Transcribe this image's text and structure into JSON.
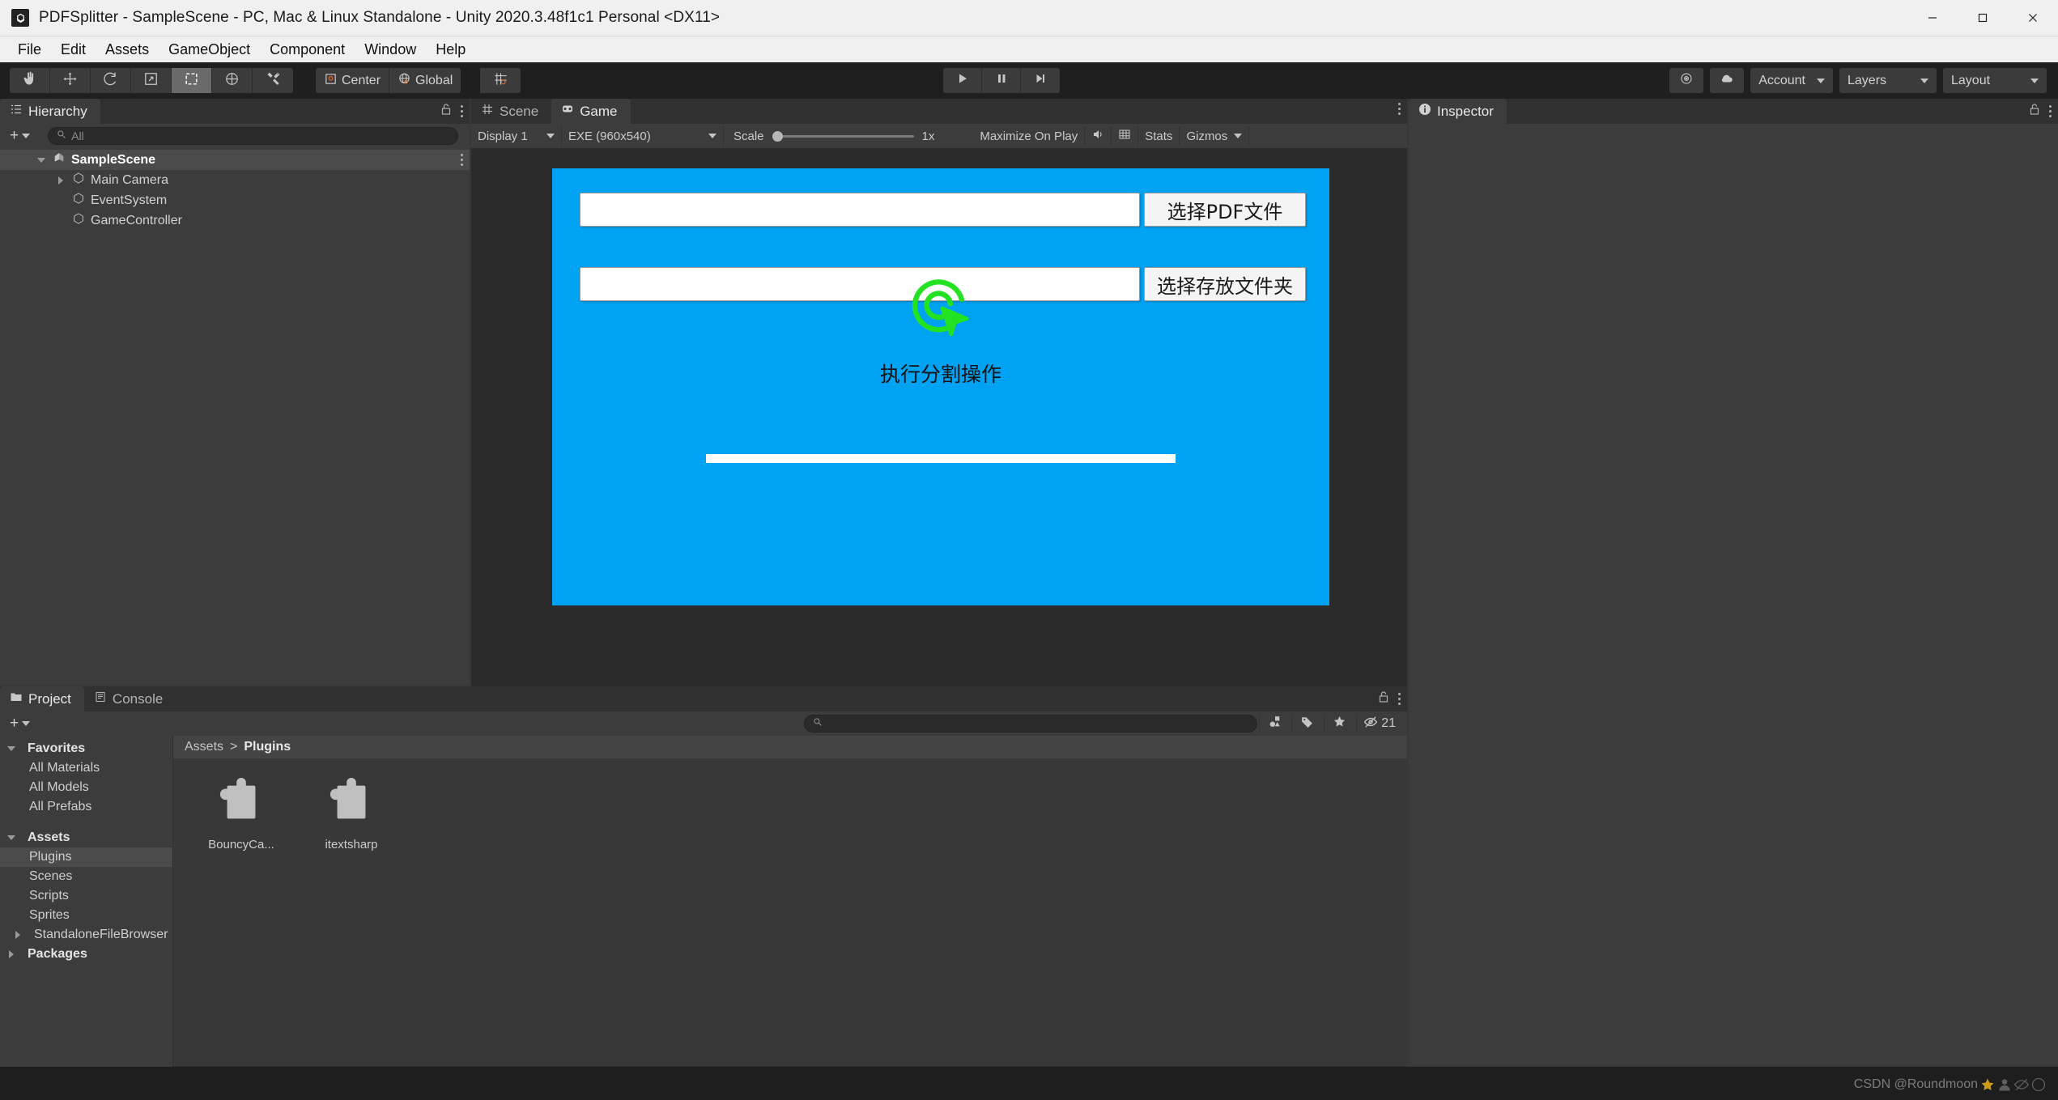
{
  "window": {
    "title": "PDFSplitter - SampleScene - PC, Mac & Linux Standalone - Unity 2020.3.48f1c1 Personal <DX11>",
    "app_icon": "unity-icon",
    "minimize_label": "Minimize",
    "maximize_label": "Maximize",
    "close_label": "Close"
  },
  "menubar": {
    "items": [
      {
        "label": "File"
      },
      {
        "label": "Edit"
      },
      {
        "label": "Assets"
      },
      {
        "label": "GameObject"
      },
      {
        "label": "Component"
      },
      {
        "label": "Window"
      },
      {
        "label": "Help"
      }
    ]
  },
  "toolbar": {
    "tools": [
      {
        "name": "hand-tool",
        "icon": "hand-icon",
        "active": false
      },
      {
        "name": "move-tool",
        "icon": "move-icon",
        "active": false
      },
      {
        "name": "rotate-tool",
        "icon": "rotate-icon",
        "active": false
      },
      {
        "name": "scale-tool",
        "icon": "scale-icon",
        "active": false
      },
      {
        "name": "rect-tool",
        "icon": "rect-icon",
        "active": true
      },
      {
        "name": "transform-tool",
        "icon": "transform-icon",
        "active": false
      },
      {
        "name": "custom-tool",
        "icon": "wrench-icon",
        "active": false
      }
    ],
    "pivot_label": "Center",
    "handle_label": "Global",
    "snap_label": "grid-snap",
    "play_label": "Play",
    "pause_label": "Pause",
    "step_label": "Step",
    "preferences_label": "preferences",
    "cloud_label": "collab",
    "account_label": "Account",
    "layers_label": "Layers",
    "layout_label": "Layout"
  },
  "hierarchy": {
    "tab_label": "Hierarchy",
    "tab_icon": "hierarchy-icon",
    "add_label": "+",
    "search_placeholder": "All",
    "items": [
      {
        "label": "SampleScene",
        "depth": 0,
        "twisty": "down",
        "icon": "scene-icon",
        "selected": true
      },
      {
        "label": "Main Camera",
        "depth": 1,
        "twisty": "right",
        "icon": "gameobject-icon",
        "selected": false
      },
      {
        "label": "EventSystem",
        "depth": 1,
        "twisty": "none",
        "icon": "gameobject-icon",
        "selected": false
      },
      {
        "label": "GameController",
        "depth": 1,
        "twisty": "none",
        "icon": "gameobject-icon",
        "selected": false
      }
    ]
  },
  "gameview": {
    "tabs": [
      {
        "label": "Scene",
        "icon": "scene-grid-icon",
        "active": false
      },
      {
        "label": "Game",
        "icon": "gamepad-icon",
        "active": true
      }
    ],
    "display_label": "Display 1",
    "resolution_label": "EXE (960x540)",
    "scale_label": "Scale",
    "scale_value": "1x",
    "maximize_label": "Maximize On Play",
    "mute_label": "mute-audio",
    "grid_label": "grid-toggle",
    "stats_label": "Stats",
    "gizmos_label": "Gizmos",
    "canvas": {
      "background_color": "#00a2f3",
      "pdf_field_value": "",
      "pdf_button_label": "选择PDF文件",
      "folder_field_value": "",
      "folder_button_label": "选择存放文件夹",
      "action_icon": "click-cursor-icon",
      "action_icon_color": "#22e222",
      "action_label": "执行分割操作",
      "progress_color": "#ffffff"
    }
  },
  "inspector": {
    "tab_label": "Inspector",
    "tab_icon": "info-icon"
  },
  "project": {
    "tabs": [
      {
        "label": "Project",
        "icon": "folder-icon",
        "active": true
      },
      {
        "label": "Console",
        "icon": "console-icon",
        "active": false
      }
    ],
    "add_label": "+",
    "search_placeholder": "",
    "search_value": "",
    "filter_type_label": "filter-by-type",
    "filter_label_label": "filter-by-label",
    "filter_favorite_label": "filter-favorites",
    "hidden_count": "21",
    "tree": [
      {
        "label": "Favorites",
        "depth": 0,
        "twisty": "down",
        "icon": "star-icon",
        "bold": true,
        "selected": false
      },
      {
        "label": "All Materials",
        "depth": 1,
        "twisty": "none",
        "icon": "search-icon",
        "bold": false,
        "selected": false
      },
      {
        "label": "All Models",
        "depth": 1,
        "twisty": "none",
        "icon": "search-icon",
        "bold": false,
        "selected": false
      },
      {
        "label": "All Prefabs",
        "depth": 1,
        "twisty": "none",
        "icon": "search-icon",
        "bold": false,
        "selected": false
      },
      {
        "label": "Assets",
        "depth": 0,
        "twisty": "down",
        "icon": "folder-open-icon",
        "bold": true,
        "selected": false
      },
      {
        "label": "Plugins",
        "depth": 1,
        "twisty": "none",
        "icon": "folder-icon",
        "bold": false,
        "selected": true
      },
      {
        "label": "Scenes",
        "depth": 1,
        "twisty": "none",
        "icon": "folder-icon",
        "bold": false,
        "selected": false
      },
      {
        "label": "Scripts",
        "depth": 1,
        "twisty": "none",
        "icon": "folder-icon",
        "bold": false,
        "selected": false
      },
      {
        "label": "Sprites",
        "depth": 1,
        "twisty": "none",
        "icon": "folder-icon",
        "bold": false,
        "selected": false
      },
      {
        "label": "StandaloneFileBrowser",
        "depth": 1,
        "twisty": "right",
        "icon": "folder-icon",
        "bold": false,
        "selected": false
      },
      {
        "label": "Packages",
        "depth": 0,
        "twisty": "right",
        "icon": "folder-icon",
        "bold": true,
        "selected": false
      }
    ],
    "breadcrumb": [
      {
        "label": "Assets",
        "current": false
      },
      {
        "label": "Plugins",
        "current": true
      }
    ],
    "breadcrumb_separator": ">",
    "assets": [
      {
        "label": "BouncyCa...",
        "icon": "plugin-icon"
      },
      {
        "label": "itextsharp",
        "icon": "plugin-icon"
      }
    ]
  },
  "statusbar": {
    "watermark": "CSDN @Roundmoon"
  }
}
